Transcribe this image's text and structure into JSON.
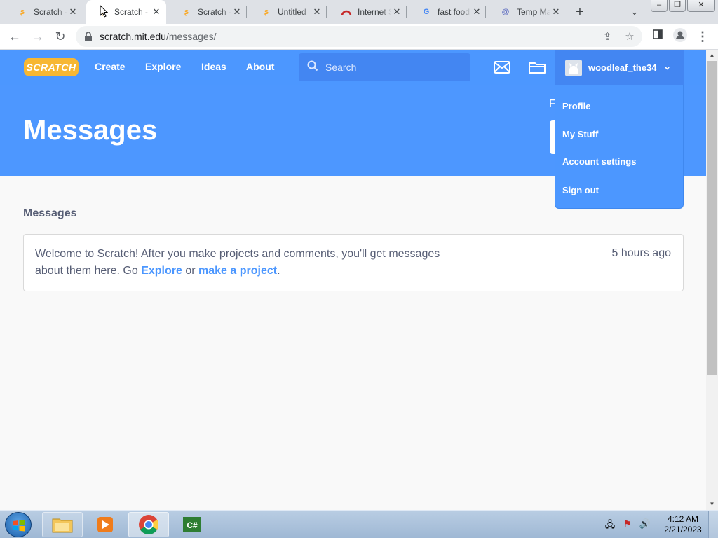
{
  "browser": {
    "tabs": [
      {
        "title": "Scratch -",
        "icon": "scratch-icon"
      },
      {
        "title": "Scratch -",
        "icon": "scratch-icon"
      },
      {
        "title": "Scratch -",
        "icon": "scratch-icon"
      },
      {
        "title": "Untitled",
        "icon": "scratch-icon"
      },
      {
        "title": "Internet S",
        "icon": "speedtest-icon"
      },
      {
        "title": "fast food",
        "icon": "google-icon"
      },
      {
        "title": "Temp Ma",
        "icon": "tempmail-icon"
      }
    ],
    "active_tab_index": 1,
    "url_host": "scratch.mit.edu",
    "url_path": "/messages/"
  },
  "navbar": {
    "logo": "SCRATCH",
    "links": [
      "Create",
      "Explore",
      "Ideas",
      "About"
    ],
    "search_placeholder": "Search",
    "username": "woodleaf_the34"
  },
  "dropdown": {
    "items": [
      "Profile",
      "My Stuff",
      "Account settings",
      "Sign out"
    ]
  },
  "banner": {
    "title": "Messages",
    "partial_label": "F"
  },
  "content": {
    "section_title": "Messages",
    "message": {
      "text_before": "Welcome to Scratch! After you make projects and comments, you'll get messages about them here. Go ",
      "link1": "Explore",
      "text_middle": " or ",
      "link2": "make a project",
      "text_after": ".",
      "time": "5 hours ago"
    }
  },
  "taskbar": {
    "time": "4:12 AM",
    "date": "2/21/2023"
  },
  "colors": {
    "scratch_blue": "#4c97ff",
    "text": "#575e75",
    "tab_strip": "#dee1e6"
  }
}
